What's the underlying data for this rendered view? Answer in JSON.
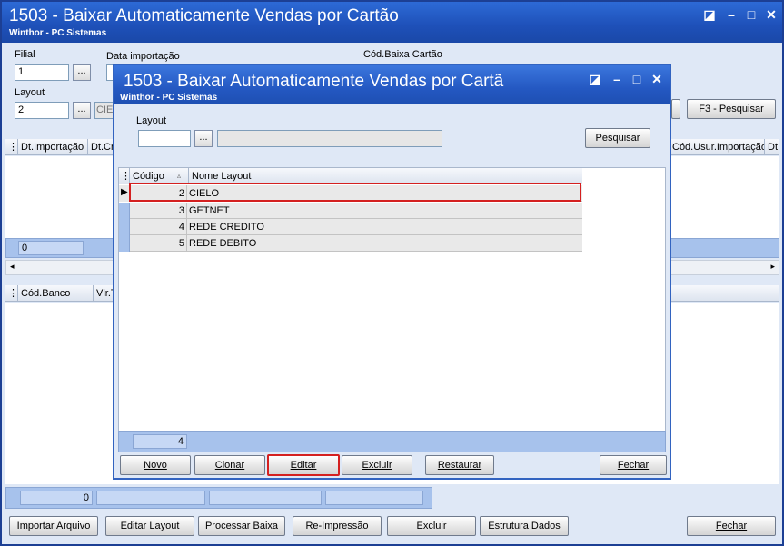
{
  "main": {
    "title": "1503 - Baixar Automaticamente Vendas por Cartão",
    "subtitle": "Winthor - PC Sistemas",
    "filial_label": "Filial",
    "filial_value": "1",
    "data_importacao_label": "Data importação",
    "cod_baixa_label": "Cód.Baixa Cartão",
    "layout_label": "Layout",
    "layout_value": "2",
    "layout_desc_partial": "CIEL",
    "ellipsis": "...",
    "f3_button": "F3 - Pesquisar",
    "grid1_headers": [
      "Dt.Importação",
      "Dt.Cri",
      "Cód.Usur.Importação",
      "Dt."
    ],
    "grid1_count": "0",
    "grid2_headers": [
      "Cód.Banco",
      "Vlr.T"
    ],
    "footer_total": "0",
    "buttons": {
      "importar": "Importar Arquivo",
      "editar_layout": "Editar Layout",
      "processar": "Processar Baixa",
      "reimpressao": "Re-Impressão",
      "excluir": "Excluir",
      "estrutura": "Estrutura Dados",
      "fechar": "Fechar"
    }
  },
  "dialog": {
    "title": "1503 - Baixar Automaticamente Vendas por Cartã",
    "subtitle": "Winthor - PC Sistemas",
    "layout_label": "Layout",
    "layout_value": "",
    "ellipsis": "...",
    "pesquisar": "Pesquisar",
    "col_codigo": "Código",
    "col_nome": "Nome Layout",
    "rows": [
      {
        "code": "2",
        "name": "CIELO"
      },
      {
        "code": "3",
        "name": "GETNET"
      },
      {
        "code": "4",
        "name": "REDE CREDITO"
      },
      {
        "code": "5",
        "name": "REDE DEBITO"
      }
    ],
    "row_count": "4",
    "buttons": {
      "novo": "Novo",
      "clonar": "Clonar",
      "editar": "Editar",
      "excluir": "Excluir",
      "restaurar": "Restaurar",
      "fechar": "Fechar"
    }
  },
  "colors": {
    "titlebar": "#1e50b8",
    "highlight_border": "#d42020",
    "panel_bg": "#dfe8f6"
  }
}
